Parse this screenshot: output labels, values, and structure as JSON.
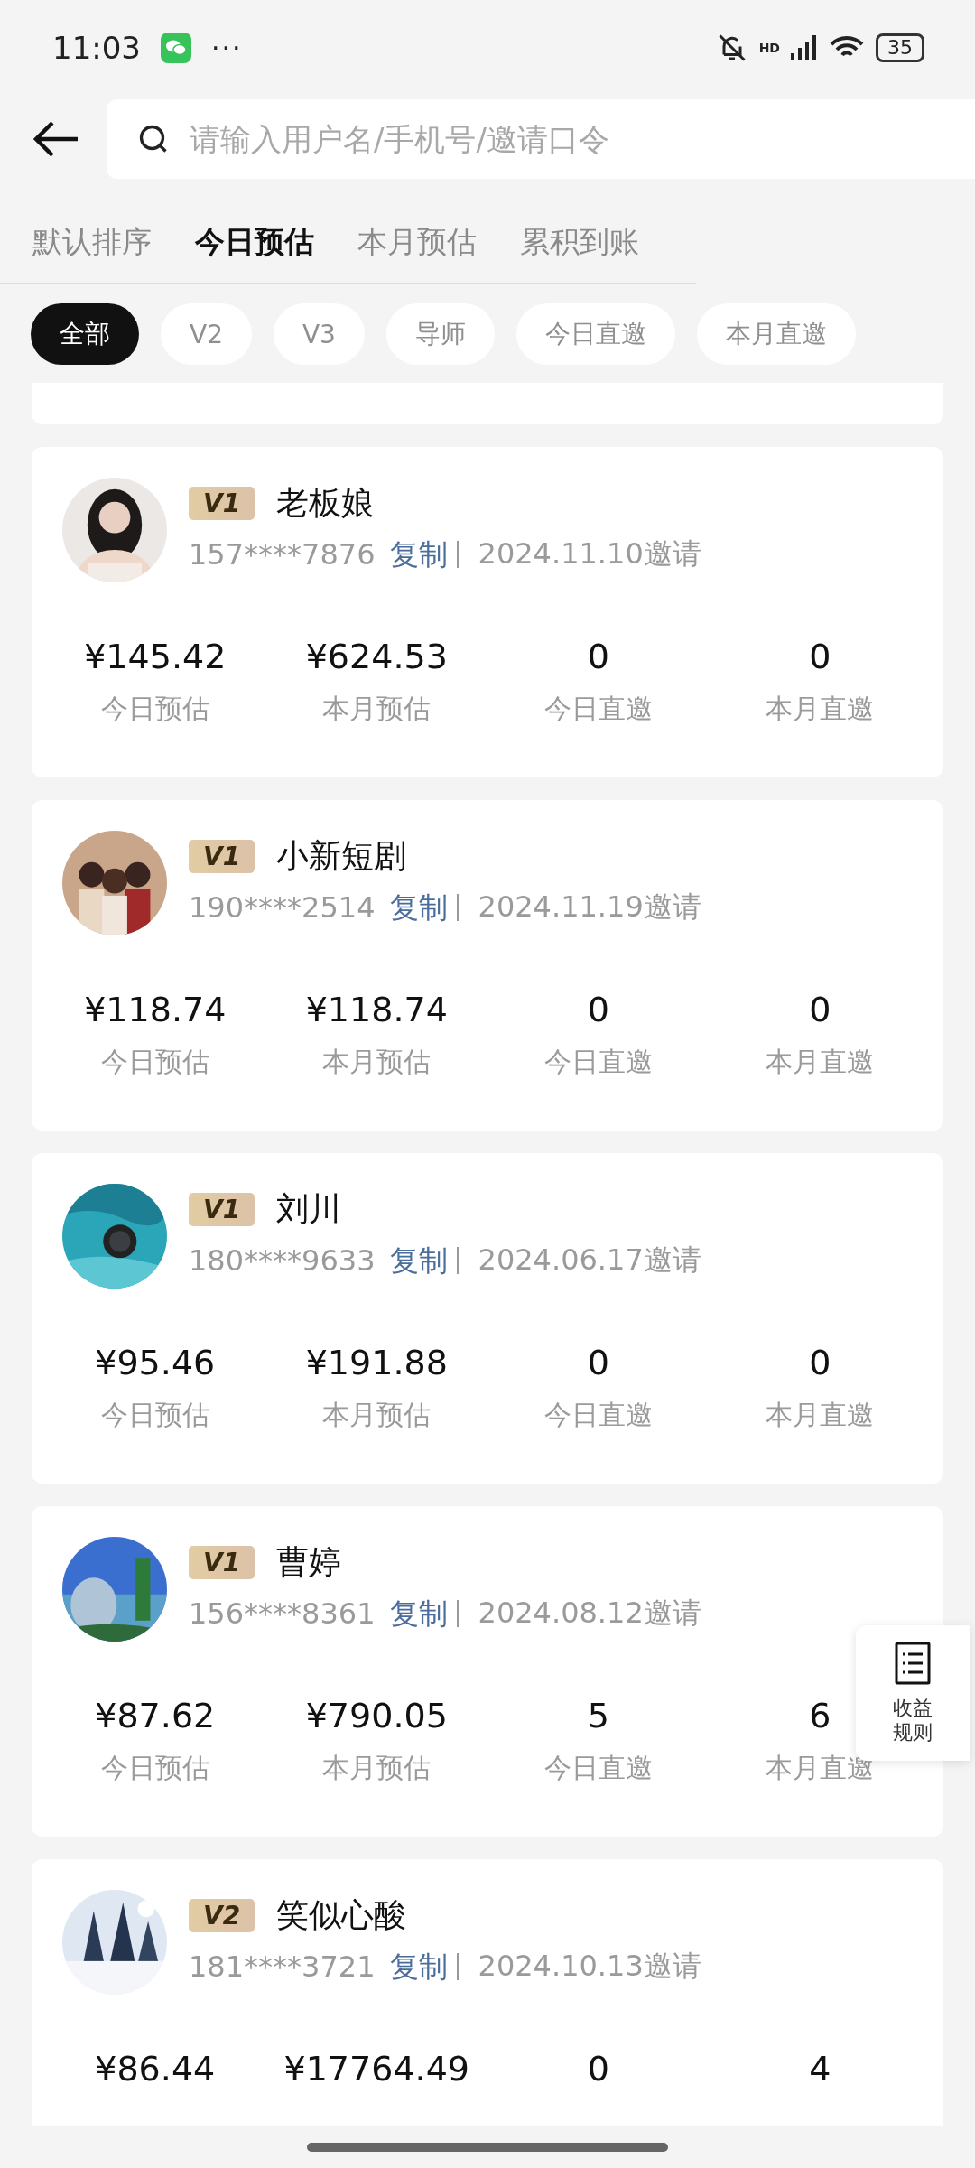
{
  "status_bar": {
    "time": "11:03",
    "more": "···",
    "signal_label": "HD",
    "battery": "35"
  },
  "search": {
    "placeholder": "请输入用户名/手机号/邀请口令"
  },
  "sort_tabs": [
    {
      "label": "默认排序",
      "selected": false
    },
    {
      "label": "今日预估",
      "selected": true
    },
    {
      "label": "本月预估",
      "selected": false
    },
    {
      "label": "累积到账",
      "selected": false
    }
  ],
  "filter_chips": [
    {
      "label": "全部",
      "selected": true
    },
    {
      "label": "V2",
      "selected": false
    },
    {
      "label": "V3",
      "selected": false
    },
    {
      "label": "导师",
      "selected": false
    },
    {
      "label": "今日直邀",
      "selected": false
    },
    {
      "label": "本月直邀",
      "selected": false
    }
  ],
  "members": [
    {
      "avatar": {
        "kind": "picture"
      },
      "level": "V1",
      "name": "老板娘",
      "phone": "157****7876",
      "copy": "复制",
      "invited": "2024.11.10邀请",
      "stats": [
        {
          "value": "¥145.42",
          "label": "今日预估"
        },
        {
          "value": "¥624.53",
          "label": "本月预估"
        },
        {
          "value": "0",
          "label": "今日直邀"
        },
        {
          "value": "0",
          "label": "本月直邀"
        }
      ]
    },
    {
      "avatar": {
        "kind": "picture"
      },
      "level": "V1",
      "name": "小新短剧",
      "phone": "190****2514",
      "copy": "复制",
      "invited": "2024.11.19邀请",
      "stats": [
        {
          "value": "¥118.74",
          "label": "今日预估"
        },
        {
          "value": "¥118.74",
          "label": "本月预估"
        },
        {
          "value": "0",
          "label": "今日直邀"
        },
        {
          "value": "0",
          "label": "本月直邀"
        }
      ]
    },
    {
      "avatar": {
        "kind": "picture"
      },
      "level": "V1",
      "name": "刘川",
      "phone": "180****9633",
      "copy": "复制",
      "invited": "2024.06.17邀请",
      "stats": [
        {
          "value": "¥95.46",
          "label": "今日预估"
        },
        {
          "value": "¥191.88",
          "label": "本月预估"
        },
        {
          "value": "0",
          "label": "今日直邀"
        },
        {
          "value": "0",
          "label": "本月直邀"
        }
      ]
    },
    {
      "avatar": {
        "kind": "picture"
      },
      "level": "V1",
      "name": "曹婷",
      "phone": "156****8361",
      "copy": "复制",
      "invited": "2024.08.12邀请",
      "stats": [
        {
          "value": "¥87.62",
          "label": "今日预估"
        },
        {
          "value": "¥790.05",
          "label": "本月预估"
        },
        {
          "value": "5",
          "label": "今日直邀"
        },
        {
          "value": "6",
          "label": "本月直邀"
        }
      ]
    },
    {
      "avatar": {
        "kind": "picture"
      },
      "level": "V2",
      "name": "笑似心酸",
      "phone": "181****3721",
      "copy": "复制",
      "invited": "2024.10.13邀请",
      "stats": [
        {
          "value": "¥86.44"
        },
        {
          "value": "¥17764.49"
        },
        {
          "value": "0"
        },
        {
          "value": "4"
        }
      ]
    }
  ],
  "rules_button": {
    "label": "收益规则"
  }
}
